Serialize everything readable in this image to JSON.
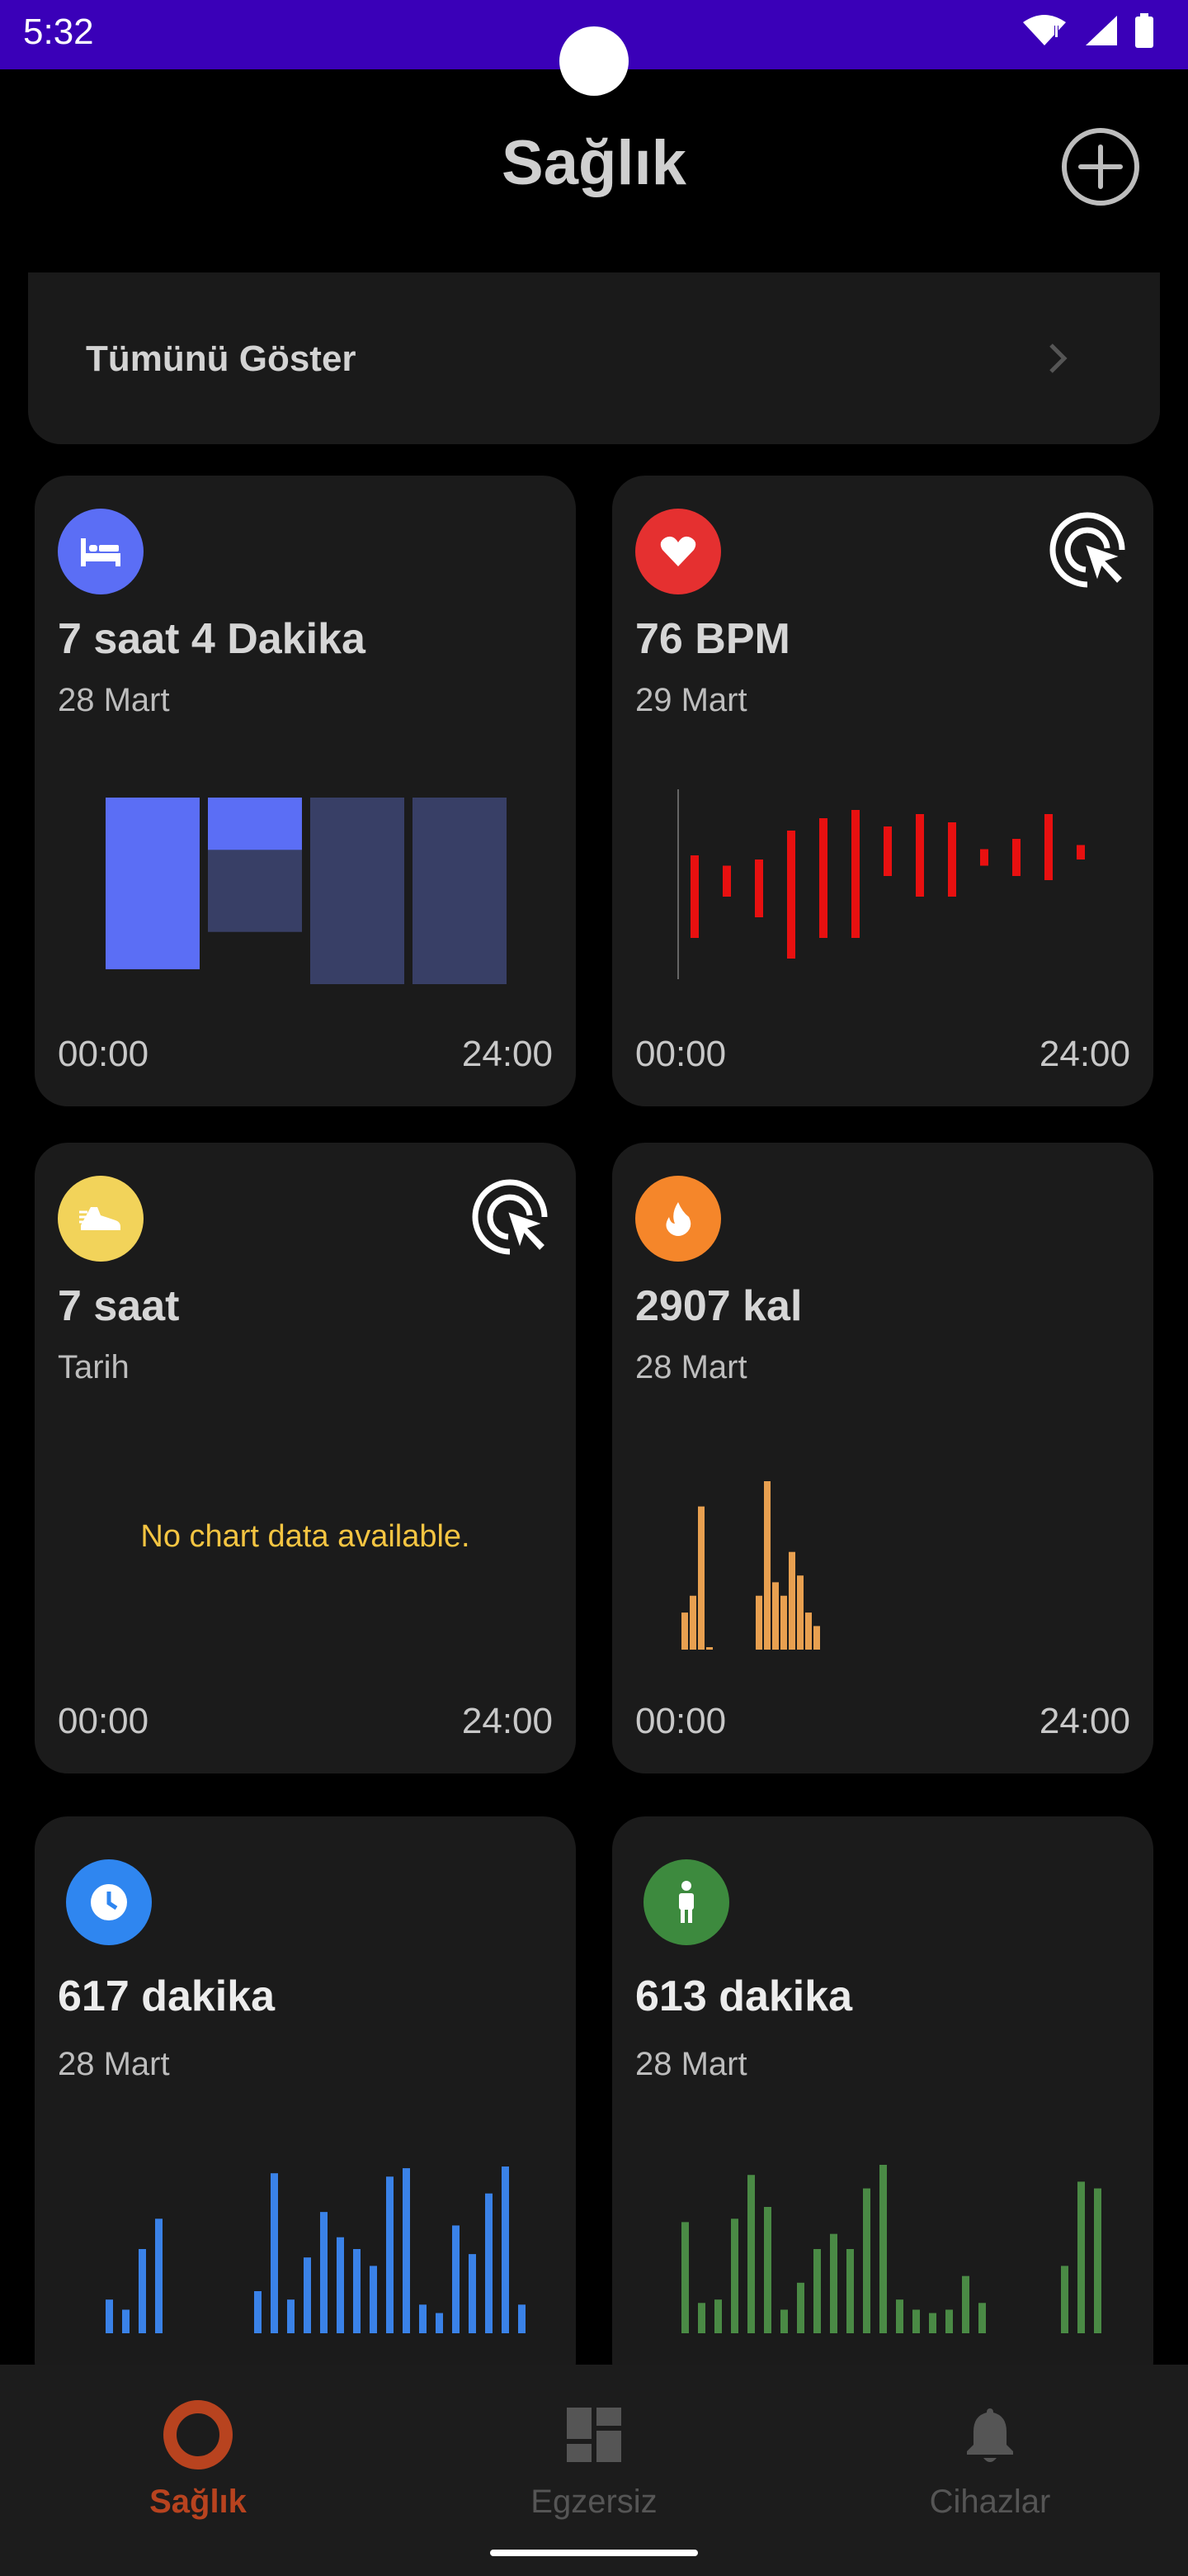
{
  "status_bar": {
    "time": "5:32"
  },
  "header": {
    "title": "Sağlık"
  },
  "show_all": {
    "label": "Tümünü Göster"
  },
  "cards": {
    "sleep": {
      "icon": "bed-icon",
      "value": "7 saat 4 Dakika",
      "date": "28 Mart",
      "start": "00:00",
      "end": "24:00",
      "color": "#5b6ef5",
      "bars": [
        {
          "deep": 0.92,
          "light": 0.08
        },
        {
          "deep": 0.28,
          "light": 0.72
        },
        {
          "deep": 0,
          "light": 1
        },
        {
          "deep": 0,
          "light": 1
        }
      ]
    },
    "heart": {
      "icon": "heart-icon",
      "value": "76 BPM",
      "date": "29 Mart",
      "start": "00:00",
      "end": "24:00",
      "color": "#e81010",
      "ranges": [
        [
          0.6,
          0.2
        ],
        [
          0.55,
          0.4
        ],
        [
          0.58,
          0.3
        ],
        [
          0.72,
          0.1
        ],
        [
          0.78,
          0.2
        ],
        [
          0.82,
          0.2
        ],
        [
          0.74,
          0.5
        ],
        [
          0.8,
          0.4
        ],
        [
          0.76,
          0.4
        ],
        [
          0.63,
          0.55
        ],
        [
          0.5,
          0.68
        ],
        [
          0.48,
          0.8
        ],
        [
          0.58,
          0.65
        ]
      ]
    },
    "steps": {
      "icon": "sneaker-icon",
      "value": "7 saat",
      "date": "Tarih",
      "start": "00:00",
      "end": "24:00",
      "no_data": "No chart data available."
    },
    "calories": {
      "icon": "flame-icon",
      "value": "2907 kal",
      "date": "28 Mart",
      "start": "00:00",
      "end": "24:00",
      "color": "#e8a050",
      "bars": [
        0.22,
        0.32,
        0.85,
        0.01,
        0,
        0,
        0,
        0,
        0,
        0.32,
        1.0,
        0.4,
        0.32,
        0.58,
        0.44,
        0.22,
        0.14
      ]
    },
    "active_time": {
      "icon": "clock-icon",
      "value": "617 dakika",
      "date": "28 Mart",
      "color": "#3a82e8",
      "bars": [
        0.2,
        0.14,
        0.5,
        0.68,
        0,
        0,
        0,
        0,
        0,
        0.25,
        0.95,
        0.2,
        0.45,
        0.72,
        0.57,
        0.5,
        0.4,
        0.93,
        0.98,
        0.17,
        0.12,
        0.64,
        0.47,
        0.83,
        0.99,
        0.17
      ]
    },
    "standing": {
      "icon": "person-standing-icon",
      "value": "613 dakika",
      "date": "28 Mart",
      "color": "#4a8a45",
      "bars": [
        0.66,
        0.18,
        0.2,
        0.68,
        0.94,
        0.75,
        0.14,
        0.3,
        0.5,
        0.59,
        0.5,
        0.86,
        1.0,
        0.2,
        0.14,
        0.12,
        0.14,
        0.34,
        0.18,
        0,
        0,
        0,
        0,
        0.4,
        0.9,
        0.86
      ]
    }
  },
  "nav": {
    "items": [
      {
        "label": "Sağlık",
        "icon": "ring-icon",
        "color": "#b8431f"
      },
      {
        "label": "Egzersiz",
        "icon": "dashboard-icon",
        "color": "#555555"
      },
      {
        "label": "Cihazlar",
        "icon": "bell-icon",
        "color": "#555555"
      }
    ]
  }
}
